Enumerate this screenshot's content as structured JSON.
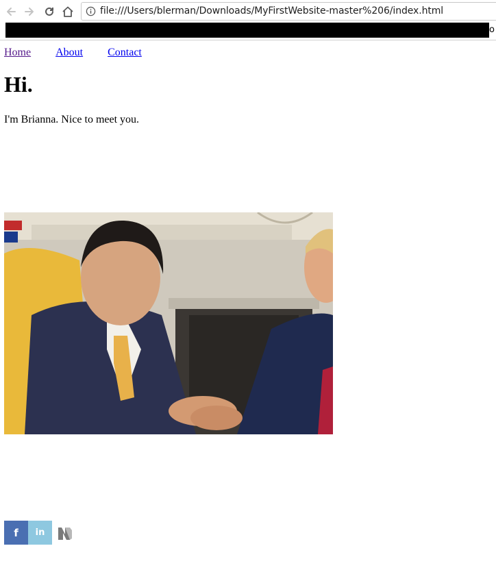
{
  "browser": {
    "url": "file:///Users/blerman/Downloads/MyFirstWebsite-master%206/index.html",
    "bookmarks_overflow": "o"
  },
  "nav": {
    "items": [
      {
        "label": "Home"
      },
      {
        "label": "About"
      },
      {
        "label": "Contact"
      }
    ]
  },
  "main": {
    "heading": "Hi.",
    "intro": "I'm Brianna. Nice to meet you."
  },
  "social": {
    "facebook_letter": "f",
    "linkedin_letters": "in"
  },
  "colors": {
    "link": "#0000ee",
    "visited_link": "#551a8b",
    "facebook": "#4a6fb2",
    "linkedin": "#8ec8e0"
  }
}
